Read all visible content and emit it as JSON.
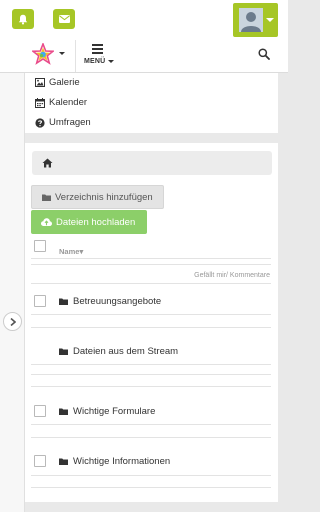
{
  "header": {
    "notifications_icon": "bell-icon",
    "messages_icon": "envelope-icon",
    "menu_label": "MENÜ",
    "search_icon": "search-icon",
    "accent_color": "#a6c626"
  },
  "sidebar": {
    "links": [
      {
        "label": "Galerie",
        "icon": "image-icon"
      },
      {
        "label": "Kalender",
        "icon": "calendar-icon"
      },
      {
        "label": "Umfragen",
        "icon": "question-circle-icon"
      }
    ]
  },
  "files": {
    "breadcrumb_icon": "home-icon",
    "add_folder_label": "Verzeichnis hinzufügen",
    "upload_label": "Dateien hochladen",
    "upload_color": "#8ccf69",
    "column_name": "Name",
    "column_likes": "Gefällt mir/ Kommentare",
    "rows": [
      {
        "label": "Betreuungsangebote"
      },
      {
        "label": "Dateien aus dem Stream"
      },
      {
        "label": "Wichtige Formulare"
      },
      {
        "label": "Wichtige Informationen"
      }
    ]
  }
}
